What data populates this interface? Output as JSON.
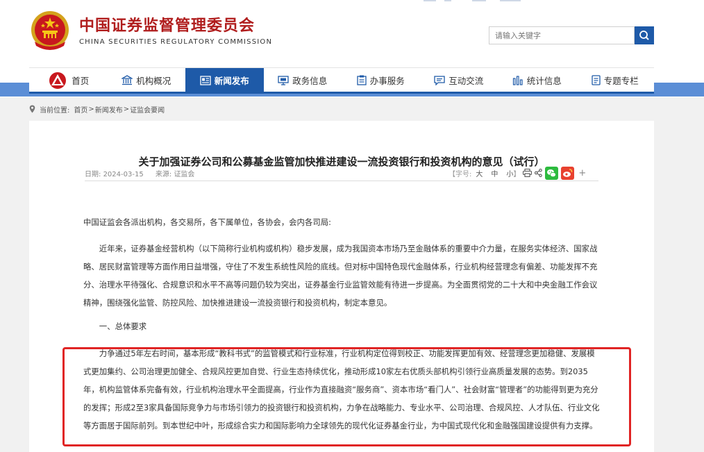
{
  "header": {
    "org_name_cn": "中国证券监督管理委员会",
    "org_name_en": "CHINA SECURITIES REGULATORY COMMISSION",
    "emblem_icon": "national-emblem-icon",
    "search": {
      "placeholder": "请输入关键字",
      "button_icon": "search-icon"
    }
  },
  "nav": {
    "items": [
      {
        "label": "首页",
        "icon": "csrc-logo-icon",
        "active": false
      },
      {
        "label": "机构概况",
        "icon": "building-icon",
        "active": false
      },
      {
        "label": "新闻发布",
        "icon": "news-icon",
        "active": true
      },
      {
        "label": "政务信息",
        "icon": "monitor-icon",
        "active": false
      },
      {
        "label": "办事服务",
        "icon": "clipboard-icon",
        "active": false
      },
      {
        "label": "互动交流",
        "icon": "chat-icon",
        "active": false
      },
      {
        "label": "统计信息",
        "icon": "bar-chart-icon",
        "active": false
      },
      {
        "label": "专题专栏",
        "icon": "document-icon",
        "active": false
      }
    ],
    "active_color": "#1e5aa8"
  },
  "breadcrumb": {
    "prefix": "当前位置:",
    "items": [
      "首页",
      "新闻发布",
      "证监会要闻"
    ],
    "separator": ">"
  },
  "article": {
    "title": "关于加强证券公司和公募基金监管加快推进建设一流投资银行和投资机构的意见（试行）",
    "date_label": "日期:",
    "date": "2024-03-15",
    "source_label": "来源:",
    "source": "证监会",
    "font_size_label": "【字号:",
    "font_sizes": [
      "大",
      "中",
      "小"
    ],
    "font_size_end": "】",
    "salutation": "中国证监会各派出机构，各交易所，各下属单位，各协会，会内各司局:",
    "paragraph_1": "近年来，证券基金经营机构（以下简称行业机构或机构）稳步发展，成为我国资本市场乃至金融体系的重要中介力量，在服务实体经济、国家战略、居民财富管理等方面作用日益增强，守住了不发生系统性风险的底线。但对标中国特色现代金融体系，行业机构经营理念有偏差、功能发挥不充分、治理水平待强化、合规意识和水平不高等问题仍较为突出，证券基金行业监管效能有待进一步提高。为全面贯彻党的二十大和中央金融工作会议精神，围绕强化监管、防控风险、加快推进建设一流投资银行和投资机构，制定本意见。",
    "heading_1": "一、总体要求",
    "paragraph_2": "力争通过5年左右时间，基本形成“教科书式”的监管模式和行业标准，行业机构定位得到校正、功能发挥更加有效、经营理念更加稳健、发展模式更加集约、公司治理更加健全、合规风控更加自觉、行业生态持续优化，推动形成10家左右优质头部机构引领行业高质量发展的态势。到2035年，机构监管体系完备有效，行业机构治理水平全面提高，行业作为直接融资“服务商”、资本市场“看门人”、社会财富“管理者”的功能得到更为充分的发挥；形成2至3家具备国际竞争力与市场引领力的投资银行和投资机构，力争在战略能力、专业水平、公司治理、合规风控、人才队伍、行业文化等方面居于国际前列。到本世纪中叶，形成综合实力和国际影响力全球领先的现代化证券基金行业，为中国式现代化和金融强国建设提供有力支撑。"
  },
  "highlight_color": "#e02424"
}
